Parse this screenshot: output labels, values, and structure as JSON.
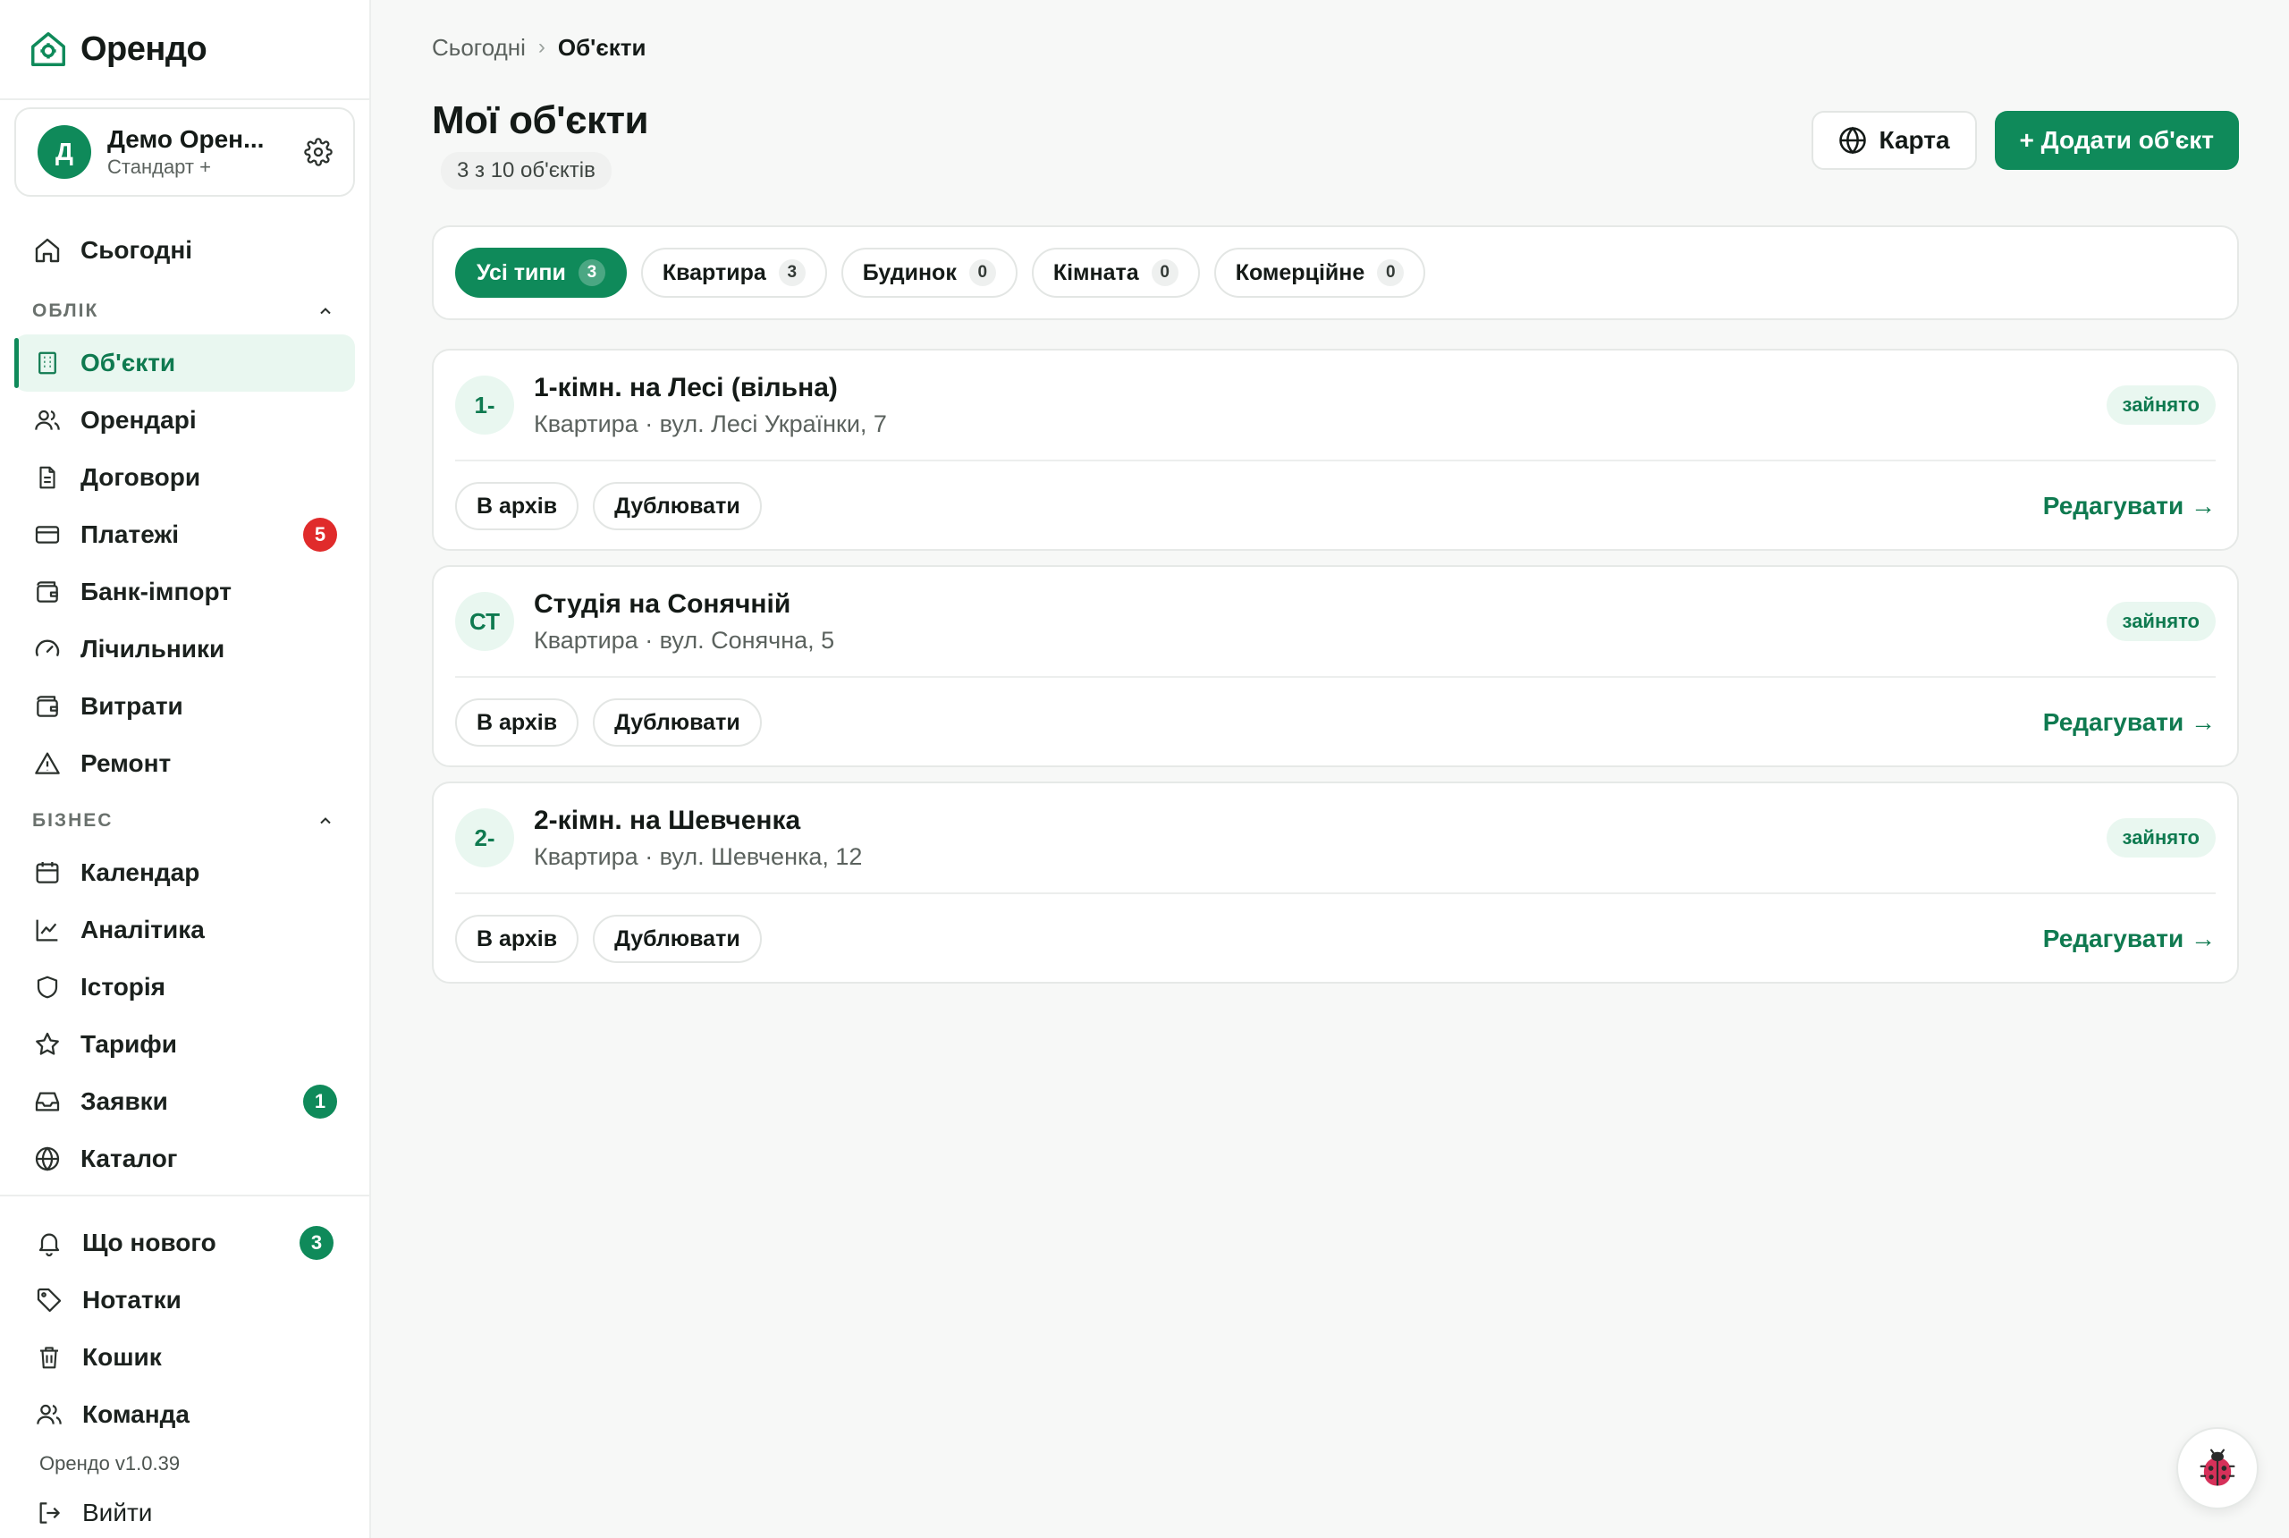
{
  "brand": {
    "name": "Орендо"
  },
  "workspace": {
    "initial": "Д",
    "name": "Демо Орен...",
    "plan": "Стандарт +"
  },
  "nav": {
    "today": "Сьогодні",
    "sections": [
      {
        "title": "ОБЛІК",
        "items": [
          {
            "label": "Об'єкти",
            "icon": "building-icon",
            "active": true
          },
          {
            "label": "Орендарі",
            "icon": "users-icon"
          },
          {
            "label": "Договори",
            "icon": "document-icon"
          },
          {
            "label": "Платежі",
            "icon": "credit-card-icon",
            "badge": "5"
          },
          {
            "label": "Банк-імпорт",
            "icon": "wallet-icon"
          },
          {
            "label": "Лічильники",
            "icon": "gauge-icon"
          },
          {
            "label": "Витрати",
            "icon": "wallet-icon"
          },
          {
            "label": "Ремонт",
            "icon": "warning-icon"
          }
        ]
      },
      {
        "title": "БІЗНЕС",
        "items": [
          {
            "label": "Календар",
            "icon": "calendar-icon"
          },
          {
            "label": "Аналітика",
            "icon": "chart-line-icon"
          },
          {
            "label": "Історія",
            "icon": "shield-icon"
          },
          {
            "label": "Тарифи",
            "icon": "star-icon"
          },
          {
            "label": "Заявки",
            "icon": "inbox-icon",
            "badge": "1"
          },
          {
            "label": "Каталог",
            "icon": "globe-icon"
          }
        ]
      }
    ],
    "bottom": [
      {
        "label": "Що нового",
        "icon": "bell-icon",
        "badge": "3"
      },
      {
        "label": "Нотатки",
        "icon": "tag-icon"
      },
      {
        "label": "Кошик",
        "icon": "trash-icon"
      },
      {
        "label": "Команда",
        "icon": "users-icon"
      }
    ],
    "version": "Орендо v1.0.39",
    "logout": "Вийти"
  },
  "breadcrumb": {
    "parent": "Сьогодні",
    "separator": "›",
    "current": "Об'єкти"
  },
  "page": {
    "title": "Мої об'єкти",
    "count": "3 з 10 об'єктів",
    "map_button": "Карта",
    "add_button": "+ Додати об'єкт"
  },
  "filters": [
    {
      "label": "Усі типи",
      "count": "3",
      "active": true
    },
    {
      "label": "Квартира",
      "count": "3"
    },
    {
      "label": "Будинок",
      "count": "0"
    },
    {
      "label": "Кімната",
      "count": "0"
    },
    {
      "label": "Комерційне",
      "count": "0"
    }
  ],
  "properties": [
    {
      "initials": "1-",
      "title": "1-кімн. на Лесі (вільна)",
      "subtitle": "Квартира · вул. Лесі Українки, 7",
      "status": "зайнято"
    },
    {
      "initials": "СТ",
      "title": "Студія на Сонячній",
      "subtitle": "Квартира · вул. Сонячна, 5",
      "status": "зайнято"
    },
    {
      "initials": "2-",
      "title": "2-кімн. на Шевченка",
      "subtitle": "Квартира · вул. Шевченка, 12",
      "status": "зайнято"
    }
  ],
  "card_actions": {
    "archive": "В архів",
    "duplicate": "Дублювати",
    "edit": "Редагувати →"
  },
  "colors": {
    "accent": "#0f8a5a",
    "accent_soft": "#e9f7f0",
    "danger": "#e02b2b"
  }
}
